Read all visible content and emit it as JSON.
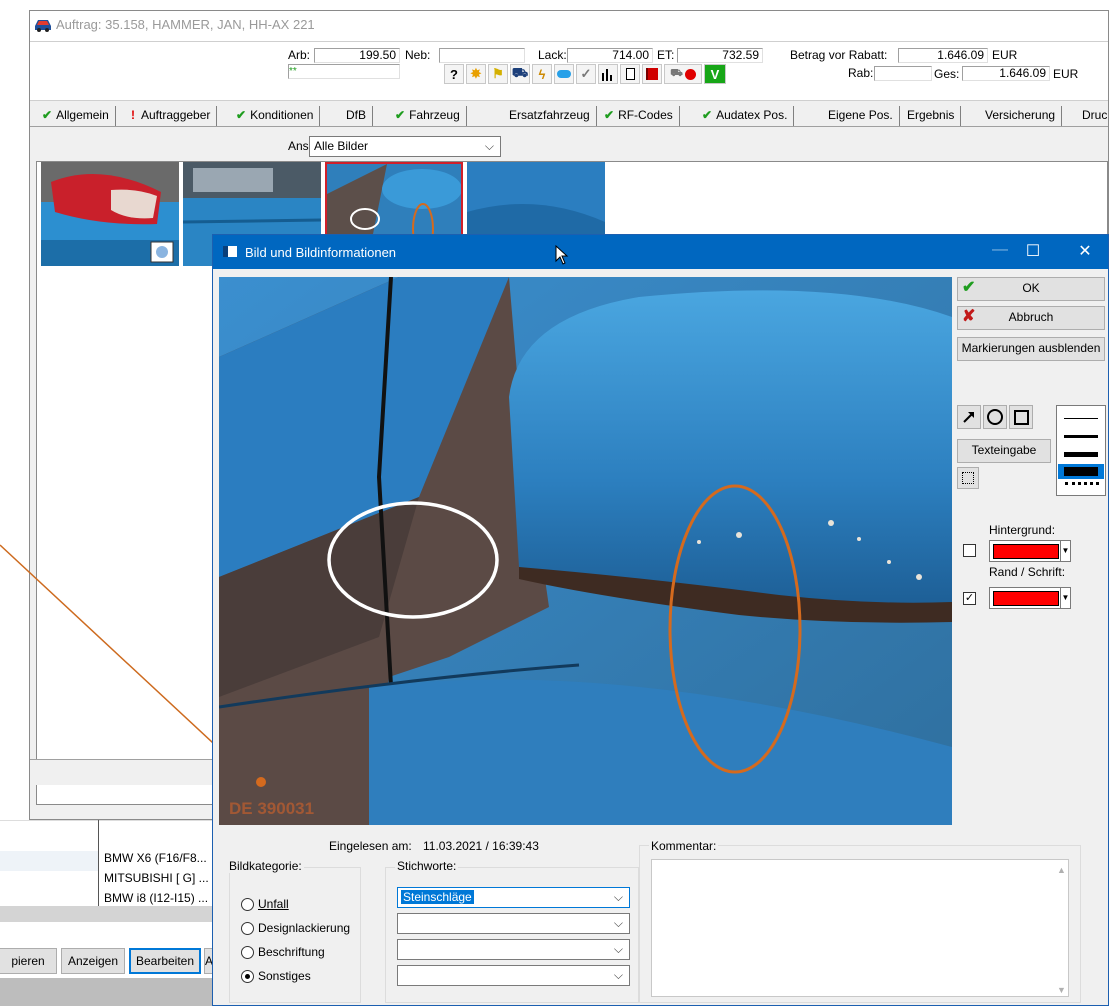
{
  "main_window": {
    "title": "Auftrag: 35.158, HAMMER, JAN, HH-AX 221",
    "header": {
      "arb_label": "Arb:",
      "arb_value": "199.50",
      "neb_label": "Neb:",
      "neb_value": "",
      "lack_label": "Lack:",
      "lack_value": "714.00",
      "et_label": "ET:",
      "et_value": "732.59",
      "betrag_label": "Betrag vor Rabatt:",
      "betrag_value": "1.646.09",
      "currency": "EUR",
      "rab_label": "Rab:",
      "rab_value": "",
      "ges_label": "Ges:",
      "ges_value": "1.646.09",
      "mini_value": "**"
    },
    "toolbar_icons": [
      "help-icon",
      "sun-icon",
      "flag-icon",
      "car-icon",
      "lightning-icon",
      "cloud-icon",
      "check-icon",
      "bar-chart-icon",
      "document-icon",
      "red-block-icon",
      "car-dot-icon",
      "v-icon"
    ],
    "tabs": [
      {
        "label": "Allgemein",
        "status": "ok"
      },
      {
        "label": "Auftraggeber",
        "status": "warn"
      },
      {
        "label": "Konditionen",
        "status": "ok"
      },
      {
        "label": "DfB",
        "status": "none"
      },
      {
        "label": "Fahrzeug",
        "status": "ok"
      },
      {
        "label": "Ersatzfahrzeug",
        "status": "none"
      },
      {
        "label": "RF-Codes",
        "status": "ok"
      },
      {
        "label": "Audatex Pos.",
        "status": "ok"
      },
      {
        "label": "Eigene Pos.",
        "status": "none"
      },
      {
        "label": "Ergebnis",
        "status": "none"
      },
      {
        "label": "Versicherung",
        "status": "none"
      },
      {
        "label": "Druc",
        "status": "none"
      }
    ],
    "tab_ok_glyph": "✔",
    "tab_warn_glyph": "!",
    "ansicht_label": "Ansicht",
    "ansicht_value": "Alle Bilder"
  },
  "vehicle_list": {
    "rows": [
      "BMW X6 (F16/F8...",
      "MITSUBISHI [ G] ...",
      "BMW i8 (I12-I15) ..."
    ]
  },
  "bottom_buttons": {
    "kopieren": "pieren",
    "anzeigen": "Anzeigen",
    "bearbeiten": "Bearbeiten",
    "extra": "A"
  },
  "dialog": {
    "title": "Bild und Bildinformationen",
    "minimize": "—",
    "maximize": "☐",
    "close": "✕",
    "ok_label": "OK",
    "cancel_label": "Abbruch",
    "toggle_markings_label": "Markierungen ausblenden",
    "text_input_label": "Texteingabe",
    "background_label": "Hintergrund:",
    "border_text_label": "Rand / Schrift:",
    "background_checked": false,
    "border_text_checked": true,
    "accent_color": "#ff0000",
    "photo_stamp": "DE 390031",
    "eingelesen_label": "Eingelesen am:",
    "eingelesen_value": "11.03.2021 / 16:39:43",
    "kommentar_label": "Kommentar:",
    "kommentar_value": "",
    "bildkategorie_label": "Bildkategorie:",
    "categories": [
      {
        "label": "Unfall",
        "selected": false
      },
      {
        "label": "Designlackierung",
        "selected": false
      },
      {
        "label": "Beschriftung",
        "selected": false
      },
      {
        "label": "Sonstiges",
        "selected": true
      }
    ],
    "stichworte_label": "Stichworte:",
    "stichworte": [
      "Steinschläge",
      "",
      "",
      ""
    ]
  }
}
